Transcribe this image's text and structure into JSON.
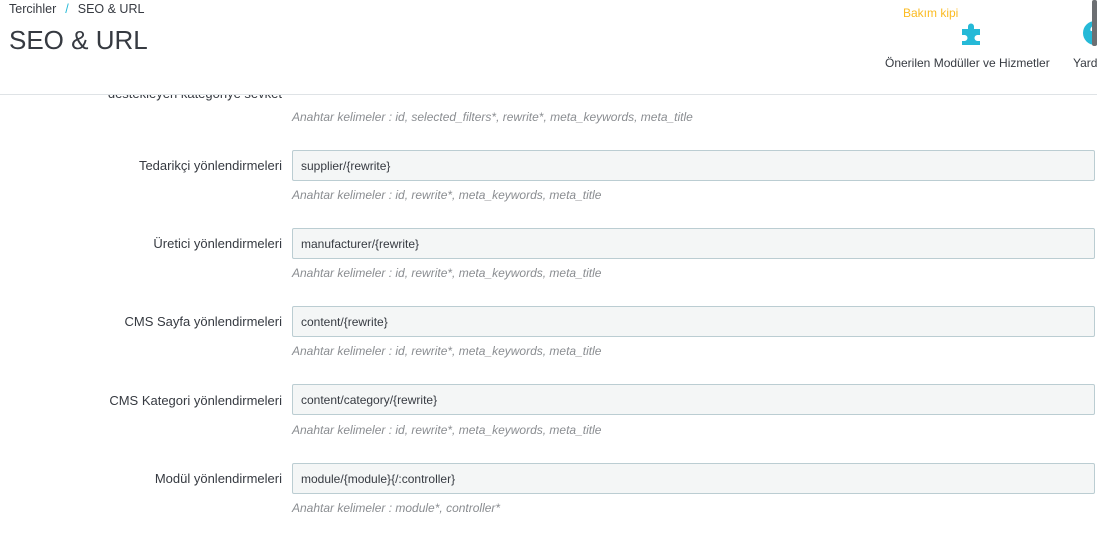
{
  "breadcrumb": {
    "parent": "Tercihler",
    "separator": "/",
    "current": "SEO & URL"
  },
  "page_title": "SEO & URL",
  "toolbar": {
    "maintenance_label": "Bakım kipi",
    "modules_label": "Önerilen Modüller ve Hizmetler",
    "help_label": "Yard"
  },
  "form": {
    "partial_label": "destekleyen kategoriye sevket",
    "partial_hint": "Anahtar kelimeler : id, selected_filters*, rewrite*, meta_keywords, meta_title",
    "rows": [
      {
        "label": "Tedarikçi yönlendirmeleri",
        "value": "supplier/{rewrite}",
        "hint": "Anahtar kelimeler : id, rewrite*, meta_keywords, meta_title"
      },
      {
        "label": "Üretici yönlendirmeleri",
        "value": "manufacturer/{rewrite}",
        "hint": "Anahtar kelimeler : id, rewrite*, meta_keywords, meta_title"
      },
      {
        "label": "CMS Sayfa yönlendirmeleri",
        "value": "content/{rewrite}",
        "hint": "Anahtar kelimeler : id, rewrite*, meta_keywords, meta_title"
      },
      {
        "label": "CMS Kategori yönlendirmeleri",
        "value": "content/category/{rewrite}",
        "hint": "Anahtar kelimeler : id, rewrite*, meta_keywords, meta_title"
      },
      {
        "label": "Modül yönlendirmeleri",
        "value": "module/{module}{/:controller}",
        "hint": "Anahtar kelimeler : module*, controller*"
      }
    ]
  },
  "colors": {
    "accent": "#25b9d7",
    "warning": "#fbbb22",
    "field_bg": "#f4f6f6",
    "field_border": "#bbcdd2",
    "hint": "#8a8d91"
  }
}
